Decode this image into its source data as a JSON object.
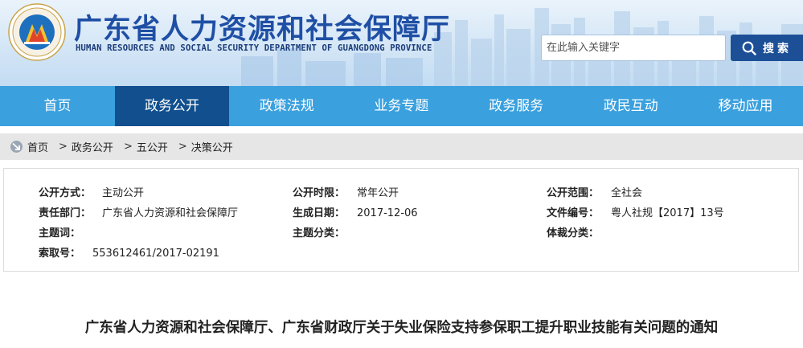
{
  "header": {
    "site_title": "广东省人力资源和社会保障厅",
    "site_subtitle": "HUMAN RESOURCES AND SOCIAL SECURITY DEPARTMENT OF GUANGDONG PROVINCE",
    "search_placeholder": "在此输入关键字",
    "search_button": "搜索"
  },
  "nav": {
    "items": [
      "首页",
      "政务公开",
      "政策法规",
      "业务专题",
      "政务服务",
      "政民互动",
      "移动应用"
    ],
    "active_index": 1
  },
  "breadcrumb": {
    "items": [
      "首页",
      "政务公开",
      "五公开",
      "决策公开"
    ],
    "separator": ">"
  },
  "meta": {
    "disclosure_method_label": "公开方式：",
    "disclosure_method": "主动公开",
    "disclosure_period_label": "公开时限：",
    "disclosure_period": "常年公开",
    "disclosure_scope_label": "公开范围：",
    "disclosure_scope": "全社会",
    "department_label": "责任部门：",
    "department": "广东省人力资源和社会保障厅",
    "date_label": "生成日期：",
    "date": "2017-12-06",
    "doc_number_label": "文件编号：",
    "doc_number": "粤人社规【2017】13号",
    "subject_label": "主题词：",
    "subject_category_label": "主题分类：",
    "genre_label": "体裁分类：",
    "index_label": "索取号：",
    "index_number": "553612461/2017-02191"
  },
  "article": {
    "title": "广东省人力资源和社会保障厅、广东省财政厅关于失业保险支持参保职工提升职业技能有关问题的通知"
  },
  "colors": {
    "nav_bg": "#3aa0de",
    "nav_active": "#114f8e",
    "title_blue": "#1f4fa5",
    "search_button": "#1c4f96"
  }
}
